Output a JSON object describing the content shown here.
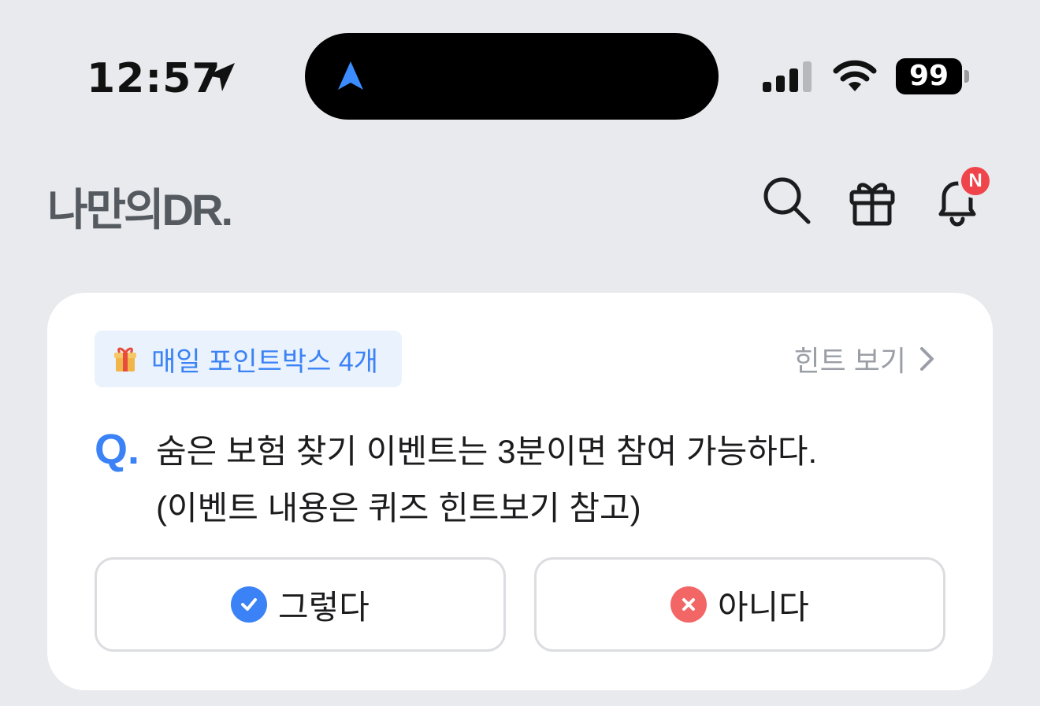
{
  "status_bar": {
    "time": "12:57",
    "battery": "99",
    "icons": [
      "location-arrow-icon",
      "navigation-icon",
      "signal-icon",
      "wifi-icon",
      "battery-icon"
    ]
  },
  "header": {
    "brand": "나만의DR.",
    "icons": [
      "search-icon",
      "gift-icon",
      "bell-icon"
    ],
    "notification_badge": "N"
  },
  "quiz": {
    "reward_pill": "매일 포인트박스 4개",
    "reward_icon": "gift-emoji-icon",
    "hint_label": "힌트 보기",
    "q_prefix": "Q.",
    "question_line1": "숨은 보험 찾기 이벤트는 3분이면 참여 가능하다.",
    "question_line2": "(이벤트 내용은 퀴즈 힌트보기 참고)",
    "answers": [
      {
        "label": "그렇다",
        "icon": "check-circle-icon",
        "color": "#3b82f6"
      },
      {
        "label": "아니다",
        "icon": "x-circle-icon",
        "color": "#f26666"
      }
    ]
  },
  "colors": {
    "background": "#e9eaee",
    "accent": "#3b82f6",
    "badge": "#f0444b"
  }
}
